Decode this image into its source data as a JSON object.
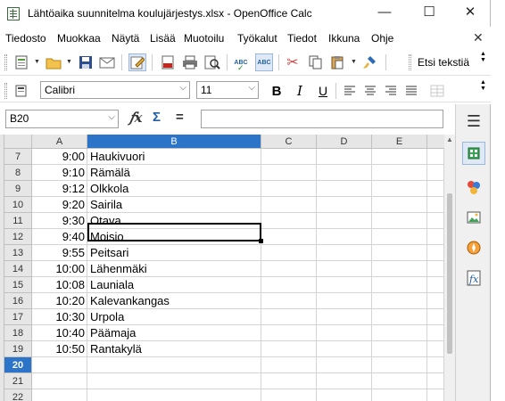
{
  "window": {
    "title": "Lähtöaika suunnitelma koulujärjestys.xlsx - OpenOffice Calc",
    "minimize": "—",
    "maximize": "☐",
    "close": "✕"
  },
  "menu": {
    "items": [
      "Tiedosto",
      "Muokkaa",
      "Näytä",
      "Lisää",
      "Muotoilu",
      "Työkalut",
      "Tiedot",
      "Ikkuna",
      "Ohje"
    ],
    "close": "✕"
  },
  "toolbar": {
    "find_label": "Etsi tekstiä",
    "font_name": "Calibri",
    "font_size": "11",
    "bold": "B",
    "italic": "I",
    "underline": "U"
  },
  "formula": {
    "cell_ref": "B20",
    "value": ""
  },
  "columns": [
    "A",
    "B",
    "C",
    "D",
    "E"
  ],
  "selected_column": "B",
  "selected_row": "20",
  "rows": [
    {
      "num": "7",
      "a": "9:00",
      "b": "Haukivuori"
    },
    {
      "num": "8",
      "a": "9:10",
      "b": "Rämälä"
    },
    {
      "num": "9",
      "a": "9:12",
      "b": "Olkkola"
    },
    {
      "num": "10",
      "a": "9:20",
      "b": "Sairila"
    },
    {
      "num": "11",
      "a": "9:30",
      "b": "Otava"
    },
    {
      "num": "12",
      "a": "9:40",
      "b": "Moisio"
    },
    {
      "num": "13",
      "a": "9:55",
      "b": "Peitsari"
    },
    {
      "num": "14",
      "a": "10:00",
      "b": "Lähenmäki"
    },
    {
      "num": "15",
      "a": "10:08",
      "b": "Launiala"
    },
    {
      "num": "16",
      "a": "10:20",
      "b": "Kalevankangas"
    },
    {
      "num": "17",
      "a": "10:30",
      "b": "Urpola"
    },
    {
      "num": "18",
      "a": "10:40",
      "b": "Päämaja"
    },
    {
      "num": "19",
      "a": "10:50",
      "b": "Rantakylä"
    },
    {
      "num": "20",
      "a": "",
      "b": ""
    },
    {
      "num": "21",
      "a": "",
      "b": ""
    },
    {
      "num": "22",
      "a": "",
      "b": ""
    }
  ]
}
